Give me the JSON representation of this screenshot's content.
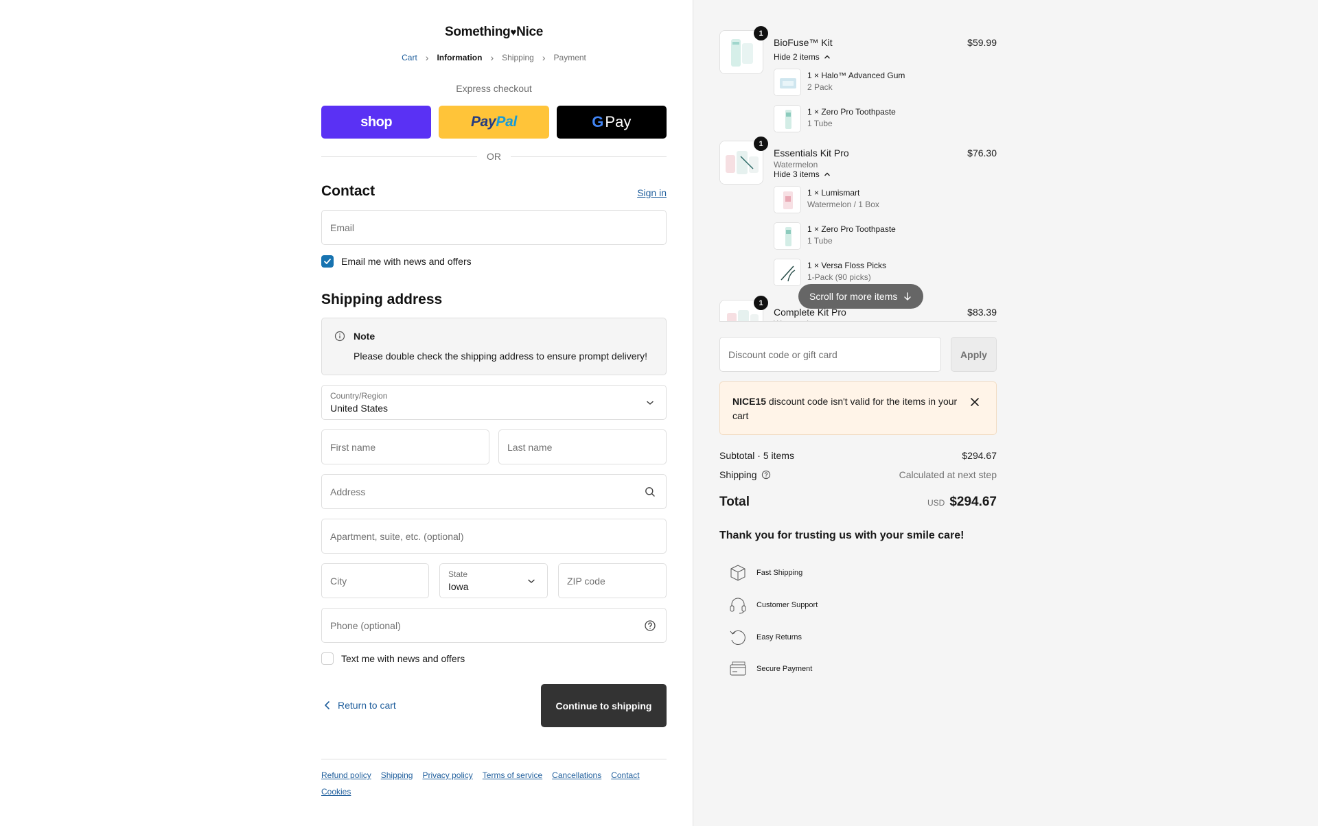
{
  "brand": {
    "name_part1": "Something",
    "name_part2": "Nice"
  },
  "breadcrumb": {
    "cart": "Cart",
    "information": "Information",
    "shipping": "Shipping",
    "payment": "Payment"
  },
  "express": {
    "label": "Express checkout",
    "shop": "shop",
    "paypal_1": "Pay",
    "paypal_2": "Pal",
    "gpay_g": "G",
    "gpay_pay": "Pay",
    "or": "OR"
  },
  "contact": {
    "title": "Contact",
    "sign_in": "Sign in",
    "email_placeholder": "Email",
    "email_optin_label": "Email me with news and offers",
    "email_optin_checked": true
  },
  "shipping_address": {
    "title": "Shipping address",
    "note_title": "Note",
    "note_text": "Please double check the shipping address to ensure prompt delivery!",
    "country_label": "Country/Region",
    "country_value": "United States",
    "first_name_placeholder": "First name",
    "last_name_placeholder": "Last name",
    "address_placeholder": "Address",
    "apartment_placeholder": "Apartment, suite, etc. (optional)",
    "city_placeholder": "City",
    "state_label": "State",
    "state_value": "Iowa",
    "zip_placeholder": "ZIP code",
    "phone_placeholder": "Phone (optional)",
    "sms_optin_label": "Text me with news and offers",
    "sms_optin_checked": false
  },
  "actions": {
    "return_label": "Return to cart",
    "continue_label": "Continue to shipping"
  },
  "footer": {
    "links": [
      "Refund policy",
      "Shipping",
      "Privacy policy",
      "Terms of service",
      "Cancellations",
      "Contact",
      "Cookies"
    ]
  },
  "order": {
    "items": [
      {
        "name": "BioFuse™ Kit",
        "quantity": "1",
        "price": "$59.99",
        "variant": "",
        "toggle": "Hide 2 items",
        "components": [
          {
            "name": "1 × Halo™ Advanced Gum",
            "variant": "2 Pack"
          },
          {
            "name": "1 × Zero Pro Toothpaste",
            "variant": "1 Tube"
          }
        ]
      },
      {
        "name": "Essentials Kit Pro",
        "quantity": "1",
        "price": "$76.30",
        "variant": "Watermelon",
        "toggle": "Hide 3 items",
        "components": [
          {
            "name": "1 × Lumismart",
            "variant": "Watermelon / 1 Box"
          },
          {
            "name": "1 × Zero Pro Toothpaste",
            "variant": "1 Tube"
          },
          {
            "name": "1 × Versa Floss Picks",
            "variant": "1-Pack (90 picks)"
          }
        ]
      },
      {
        "name": "Complete Kit Pro",
        "quantity": "1",
        "price": "$83.39",
        "variant": "Watermelon"
      }
    ],
    "scroll_hint": "Scroll for more items",
    "discount_placeholder": "Discount code or gift card",
    "apply_label": "Apply",
    "alert_code": "NICE15",
    "alert_text": " discount code isn't valid for the items in your cart",
    "subtotal_label": "Subtotal · 5 items",
    "subtotal_value": "$294.67",
    "shipping_label": "Shipping",
    "shipping_value": "Calculated at next step",
    "total_label": "Total",
    "total_currency": "USD",
    "total_value": "$294.67",
    "thanks": "Thank you for trusting us with your smile care!",
    "features": [
      {
        "label": "Fast Shipping",
        "icon": "box-icon"
      },
      {
        "label": "Customer Support",
        "icon": "headset-icon"
      },
      {
        "label": "Easy Returns",
        "icon": "return-icon"
      },
      {
        "label": "Secure Payment",
        "icon": "card-icon"
      }
    ]
  },
  "colors": {
    "accent": "#1773b0",
    "link": "#1f5e9c",
    "shop": "#5a31f4",
    "paypal": "#ffc439",
    "button_dark": "#333333",
    "alert_bg": "#fff4e8"
  }
}
